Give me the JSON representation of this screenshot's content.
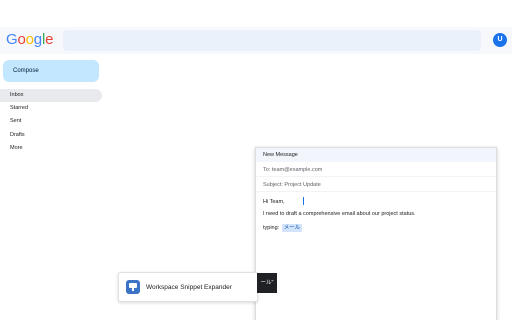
{
  "header": {
    "logo_letters": [
      {
        "char": "G",
        "color": "#4285F4"
      },
      {
        "char": "o",
        "color": "#EA4335"
      },
      {
        "char": "o",
        "color": "#FBBC05"
      },
      {
        "char": "g",
        "color": "#4285F4"
      },
      {
        "char": "l",
        "color": "#34A853"
      },
      {
        "char": "e",
        "color": "#EA4335"
      }
    ],
    "avatar_initial": "U"
  },
  "sidebar": {
    "compose_label": "Compose",
    "items": [
      {
        "label": "Inbox",
        "active": true
      },
      {
        "label": "Starred",
        "active": false
      },
      {
        "label": "Sent",
        "active": false
      },
      {
        "label": "Drafts",
        "active": false
      },
      {
        "label": "More",
        "active": false
      }
    ]
  },
  "compose_window": {
    "title": "New Message",
    "to": "To: team@example.com",
    "subject": "Subject: Project Update",
    "body_lines": [
      "Hi Team,",
      "I need to draft a comprehensive email about our project status."
    ],
    "typing_label": "typing:",
    "typing_value": "メール"
  },
  "ime_popup": {
    "text": "ール\""
  },
  "snippet_bar": {
    "label": "Workspace Snippet Expander",
    "icon": "monitor-icon"
  }
}
